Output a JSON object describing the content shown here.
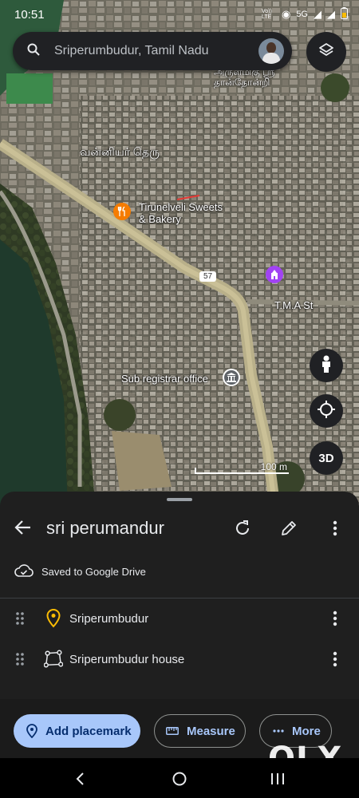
{
  "status_bar": {
    "time": "10:51",
    "network_label": "Vo)) LTE",
    "network_type": "5G"
  },
  "search": {
    "value": "Sriperumbudur, Tamil Nadu"
  },
  "map": {
    "labels": {
      "temple_tamil": "அருள்மிகு ஸ்ரீ தான்தோன்றி",
      "street_tamil": "வன்னியர் தெரு",
      "restaurant": "Tirunelveli Sweets & Bakery",
      "registrar": "Sub registrar office",
      "road_number": "57",
      "street": "T.M.A St"
    },
    "fab_3d": "3D",
    "scale": "100 m"
  },
  "sheet": {
    "title": "sri perumandur",
    "saved_status": "Saved to Google Drive",
    "items": [
      {
        "label": "Sriperumbudur",
        "icon": "placemark-icon"
      },
      {
        "label": "Sriperumbudur house",
        "icon": "polygon-icon"
      }
    ]
  },
  "actions": {
    "add_placemark": "Add placemark",
    "measure": "Measure",
    "more": "More"
  },
  "watermark": "OLX",
  "colors": {
    "sheet_bg": "#1f1f1f",
    "primary_chip": "#a8c7fa",
    "placemark": "#fbbc04",
    "restaurant_poi": "#f57c00",
    "temple_poi": "#a142f4",
    "registrar_poi": "#5f6368"
  }
}
